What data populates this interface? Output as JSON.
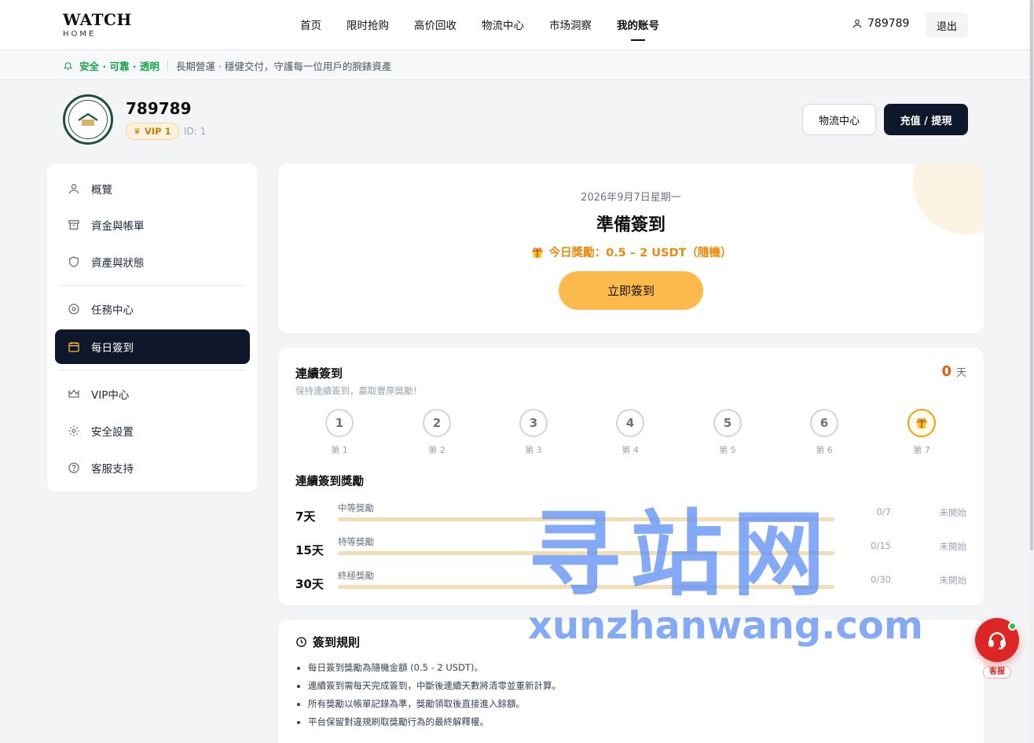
{
  "header": {
    "logo_main": "WATCH",
    "logo_sub": "HOME",
    "nav": [
      {
        "label": "首页"
      },
      {
        "label": "限时抢购"
      },
      {
        "label": "高价回收"
      },
      {
        "label": "物流中心"
      },
      {
        "label": "市场洞察"
      },
      {
        "label": "我的账号",
        "active": true
      }
    ],
    "user": "789789",
    "logout_label": "退出"
  },
  "notice": {
    "highlight": "安全 · 可靠 · 透明",
    "text": "長期營運 · 穩健交付，守護每一位用戶的腕錶資產"
  },
  "profile": {
    "username": "789789",
    "vip": "VIP 1",
    "id_text": "ID: 1",
    "logistics_button": "物流中心",
    "deposit_button": "充值 / 提現"
  },
  "sidebar": {
    "items": [
      {
        "label": "概覽",
        "icon": "user-icon"
      },
      {
        "label": "資金與帳單",
        "icon": "archive-icon"
      },
      {
        "label": "資產與狀態",
        "icon": "shield-icon"
      },
      {
        "label": "任務中心",
        "icon": "target-icon"
      },
      {
        "label": "每日簽到",
        "icon": "calendar-icon",
        "active": true
      },
      {
        "label": "VIP中心",
        "icon": "crown-icon"
      },
      {
        "label": "安全設置",
        "icon": "gear-icon"
      },
      {
        "label": "客服支持",
        "icon": "help-icon"
      }
    ]
  },
  "checkin": {
    "date": "2026年9月7日星期一",
    "title": "準備簽到",
    "reward": "今日獎勵：0.5 – 2 USDT（隨機）",
    "button": "立即簽到"
  },
  "streak": {
    "title": "連續簽到",
    "subtitle": "保持連續簽到，贏取豐厚獎勵！",
    "count": "0",
    "unit": "天",
    "days": [
      {
        "num": "1",
        "label": "第 1"
      },
      {
        "num": "2",
        "label": "第 2"
      },
      {
        "num": "3",
        "label": "第 3"
      },
      {
        "num": "4",
        "label": "第 4"
      },
      {
        "num": "5",
        "label": "第 5"
      },
      {
        "num": "6",
        "label": "第 6"
      },
      {
        "num": "",
        "label": "第 7",
        "gift": true
      }
    ],
    "rewards_title": "連續簽到獎勵",
    "rewards": [
      {
        "days": "7天",
        "name": "中等獎勵",
        "progress": "0/7",
        "ratio": 0,
        "status": "未開始"
      },
      {
        "days": "15天",
        "name": "特等獎勵",
        "progress": "0/15",
        "ratio": 0,
        "status": "未開始"
      },
      {
        "days": "30天",
        "name": "終極獎勵",
        "progress": "0/30",
        "ratio": 0,
        "status": "未開始"
      }
    ]
  },
  "rules": {
    "title": "簽到規則",
    "items": [
      "每日簽到獎勵為隨機金額 (0.5 - 2 USDT)。",
      "連續簽到需每天完成簽到，中斷後連續天數將清零並重新計算。",
      "所有獎勵以帳單記錄為準，獎勵領取後直接進入餘額。",
      "平台保留對違規刷取獎勵行為的最終解釋權。"
    ]
  },
  "watermark": {
    "cn": "寻站网",
    "en": "xunzhanwang.com"
  },
  "support_float": {
    "label": "客服"
  },
  "colors": {
    "primary_dark": "#0f172a",
    "accent_orange": "#fdba4c",
    "success_green": "#16a34a",
    "support_red": "#dc2626"
  }
}
